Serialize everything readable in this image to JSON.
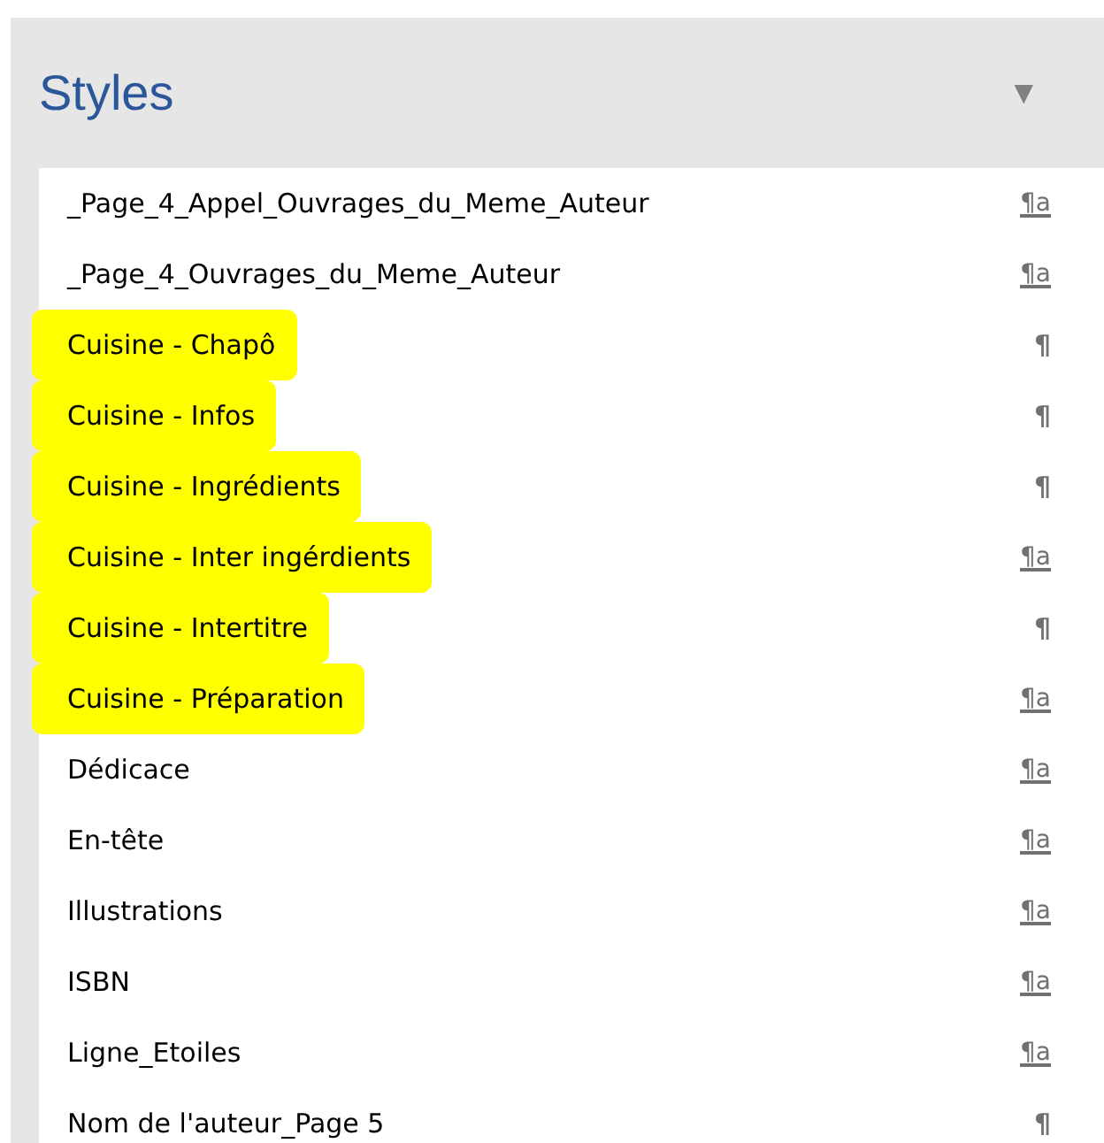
{
  "panel": {
    "title": "Styles",
    "menu_arrow": "▼"
  },
  "styles": [
    {
      "name": "_Page_4_Appel_Ouvrages_du_Meme_Auteur",
      "kind": "linked",
      "symbol": "¶a",
      "highlighted": false
    },
    {
      "name": "_Page_4_Ouvrages_du_Meme_Auteur",
      "kind": "linked",
      "symbol": "¶a",
      "highlighted": false
    },
    {
      "name": "Cuisine - Chapô",
      "kind": "paragraph",
      "symbol": "¶",
      "highlighted": true
    },
    {
      "name": "Cuisine - Infos",
      "kind": "paragraph",
      "symbol": "¶",
      "highlighted": true
    },
    {
      "name": "Cuisine - Ingrédients",
      "kind": "paragraph",
      "symbol": "¶",
      "highlighted": true
    },
    {
      "name": "Cuisine - Inter ingérdients",
      "kind": "linked",
      "symbol": "¶a",
      "highlighted": true
    },
    {
      "name": "Cuisine - Intertitre",
      "kind": "paragraph",
      "symbol": "¶",
      "highlighted": true
    },
    {
      "name": "Cuisine - Préparation",
      "kind": "linked",
      "symbol": "¶a",
      "highlighted": true
    },
    {
      "name": "Dédicace",
      "kind": "linked",
      "symbol": "¶a",
      "highlighted": false
    },
    {
      "name": "En-tête",
      "kind": "linked",
      "symbol": "¶a",
      "highlighted": false
    },
    {
      "name": "Illustrations",
      "kind": "linked",
      "symbol": "¶a",
      "highlighted": false
    },
    {
      "name": "ISBN",
      "kind": "linked",
      "symbol": "¶a",
      "highlighted": false
    },
    {
      "name": "Ligne_Etoiles",
      "kind": "linked",
      "symbol": "¶a",
      "highlighted": false
    },
    {
      "name": "Nom de l'auteur_Page 5",
      "kind": "paragraph",
      "symbol": "¶",
      "highlighted": false
    }
  ]
}
